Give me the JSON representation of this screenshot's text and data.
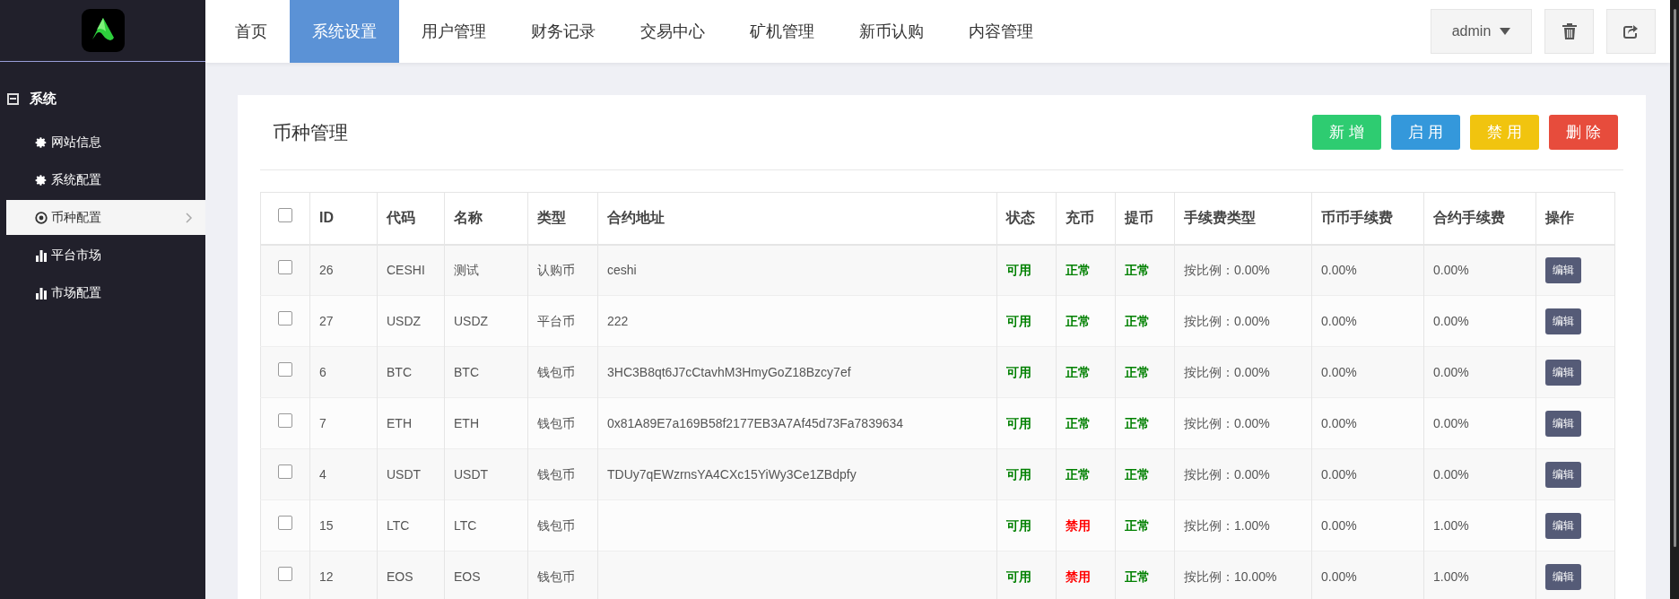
{
  "sidebar": {
    "group": {
      "label": "系统",
      "expanded": true
    },
    "items": [
      {
        "label": "网站信息",
        "kind": "gear",
        "selected": false
      },
      {
        "label": "系统配置",
        "kind": "gear",
        "selected": false
      },
      {
        "label": "币种配置",
        "kind": "target",
        "selected": true
      },
      {
        "label": "平台市场",
        "kind": "bars",
        "selected": false
      },
      {
        "label": "市场配置",
        "kind": "bars",
        "selected": false
      }
    ]
  },
  "nav": {
    "tabs": [
      {
        "label": "首页",
        "selected": false
      },
      {
        "label": "系统设置",
        "selected": true
      },
      {
        "label": "用户管理",
        "selected": false
      },
      {
        "label": "财务记录",
        "selected": false
      },
      {
        "label": "交易中心",
        "selected": false
      },
      {
        "label": "矿机管理",
        "selected": false
      },
      {
        "label": "新币认购",
        "selected": false
      },
      {
        "label": "内容管理",
        "selected": false
      }
    ],
    "user": "admin"
  },
  "card": {
    "title": "币种管理",
    "actions": [
      {
        "label": "新 增",
        "kind": "add"
      },
      {
        "label": "启 用",
        "kind": "enable"
      },
      {
        "label": "禁 用",
        "kind": "disable"
      },
      {
        "label": "删 除",
        "kind": "delete"
      }
    ],
    "table": {
      "columns": [
        "ID",
        "代码",
        "名称",
        "类型",
        "合约地址",
        "状态",
        "充币",
        "提币",
        "手续费类型",
        "币币手续费",
        "合约手续费",
        "操作"
      ],
      "header_checked": false,
      "rows": [
        {
          "checked": false,
          "id": "26",
          "code": "CESHI",
          "name": "测试",
          "type": "认购币",
          "address": "ceshi",
          "status": {
            "text": "可用",
            "enabled": true
          },
          "deposit": {
            "text": "正常",
            "enabled": true
          },
          "withdraw": {
            "text": "正常",
            "enabled": true
          },
          "fee_type": "按比例：0.00%",
          "spot_fee": "0.00%",
          "contract_fee": "0.00%",
          "action": "编辑"
        },
        {
          "checked": false,
          "id": "27",
          "code": "USDZ",
          "name": "USDZ",
          "type": "平台币",
          "address": "222",
          "status": {
            "text": "可用",
            "enabled": true
          },
          "deposit": {
            "text": "正常",
            "enabled": true
          },
          "withdraw": {
            "text": "正常",
            "enabled": true
          },
          "fee_type": "按比例：0.00%",
          "spot_fee": "0.00%",
          "contract_fee": "0.00%",
          "action": "编辑"
        },
        {
          "checked": false,
          "id": "6",
          "code": "BTC",
          "name": "BTC",
          "type": "钱包币",
          "address": "3HC3B8qt6J7cCtavhM3HmyGoZ18Bzcy7ef",
          "status": {
            "text": "可用",
            "enabled": true
          },
          "deposit": {
            "text": "正常",
            "enabled": true
          },
          "withdraw": {
            "text": "正常",
            "enabled": true
          },
          "fee_type": "按比例：0.00%",
          "spot_fee": "0.00%",
          "contract_fee": "0.00%",
          "action": "编辑"
        },
        {
          "checked": false,
          "id": "7",
          "code": "ETH",
          "name": "ETH",
          "type": "钱包币",
          "address": "0x81A89E7a169B58f2177EB3A7Af45d73Fa7839634",
          "status": {
            "text": "可用",
            "enabled": true
          },
          "deposit": {
            "text": "正常",
            "enabled": true
          },
          "withdraw": {
            "text": "正常",
            "enabled": true
          },
          "fee_type": "按比例：0.00%",
          "spot_fee": "0.00%",
          "contract_fee": "0.00%",
          "action": "编辑"
        },
        {
          "checked": false,
          "id": "4",
          "code": "USDT",
          "name": "USDT",
          "type": "钱包币",
          "address": "TDUy7qEWzrnsYA4CXc15YiWy3Ce1ZBdpfy",
          "status": {
            "text": "可用",
            "enabled": true
          },
          "deposit": {
            "text": "正常",
            "enabled": true
          },
          "withdraw": {
            "text": "正常",
            "enabled": true
          },
          "fee_type": "按比例：0.00%",
          "spot_fee": "0.00%",
          "contract_fee": "0.00%",
          "action": "编辑"
        },
        {
          "checked": false,
          "id": "15",
          "code": "LTC",
          "name": "LTC",
          "type": "钱包币",
          "status": {
            "text": "可用",
            "enabled": true
          },
          "deposit": {
            "text": "禁用",
            "enabled": false
          },
          "withdraw": {
            "text": "正常",
            "enabled": true
          },
          "fee_type": "按比例：1.00%",
          "spot_fee": "0.00%",
          "contract_fee": "1.00%",
          "action": "编辑"
        },
        {
          "checked": false,
          "id": "12",
          "code": "EOS",
          "name": "EOS",
          "type": "钱包币",
          "status": {
            "text": "可用",
            "enabled": true
          },
          "deposit": {
            "text": "禁用",
            "enabled": false
          },
          "withdraw": {
            "text": "正常",
            "enabled": true
          },
          "fee_type": "按比例：10.00%",
          "spot_fee": "0.00%",
          "contract_fee": "1.00%",
          "action": "编辑"
        }
      ]
    }
  }
}
